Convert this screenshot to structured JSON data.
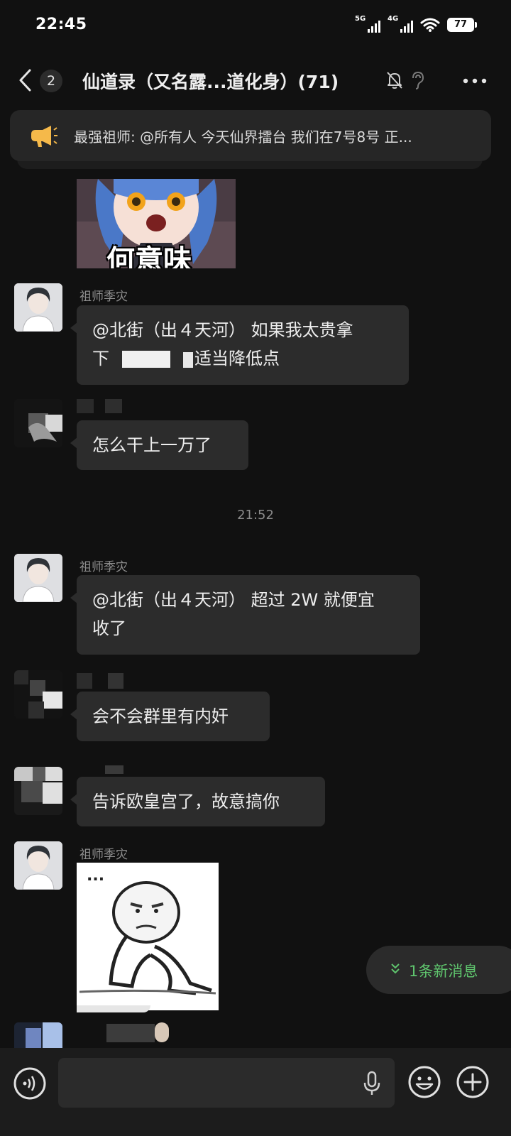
{
  "status_bar": {
    "time": "22:45",
    "network_1": "5G",
    "network_2": "4G",
    "battery": "77"
  },
  "header": {
    "unread_count": "2",
    "title": "仙道录（又名露...道化身）(71)"
  },
  "announcement": {
    "text": "最强祖师: @所有人 今天仙界擂台 我们在7号8号 正..."
  },
  "messages": [
    {
      "type": "sticker",
      "caption": "何意味"
    },
    {
      "type": "text",
      "sender": "祖师季灾",
      "lines": [
        "@北街（出４天河） 如果我太贵拿",
        "下　　　　　适当降低点"
      ]
    },
    {
      "type": "text",
      "sender": "",
      "lines": [
        "怎么干上一万了"
      ]
    },
    {
      "type": "time",
      "text": "21:52"
    },
    {
      "type": "text",
      "sender": "祖师季灾",
      "lines": [
        "@北街（出４天河） 超过 2W 就便宜",
        "收了"
      ]
    },
    {
      "type": "text",
      "sender": "",
      "lines": [
        "会不会群里有内奸"
      ]
    },
    {
      "type": "text",
      "sender": "",
      "lines": [
        "告诉欧皇宫了，故意搞你"
      ]
    },
    {
      "type": "sticker",
      "sender": "祖师季灾",
      "caption": "..."
    }
  ],
  "new_messages_label": "1条新消息",
  "input": {
    "placeholder": ""
  },
  "colors": {
    "background": "#111111",
    "bubble": "#2c2c2c",
    "accent_green": "#5fc46d",
    "notice_icon": "#f5b94a"
  },
  "icons": [
    "back-icon",
    "mute-icon",
    "ear-icon",
    "more-icon",
    "megaphone-icon",
    "voice-icon",
    "mic-icon",
    "emoji-icon",
    "plus-icon",
    "chevron-down-icon"
  ]
}
